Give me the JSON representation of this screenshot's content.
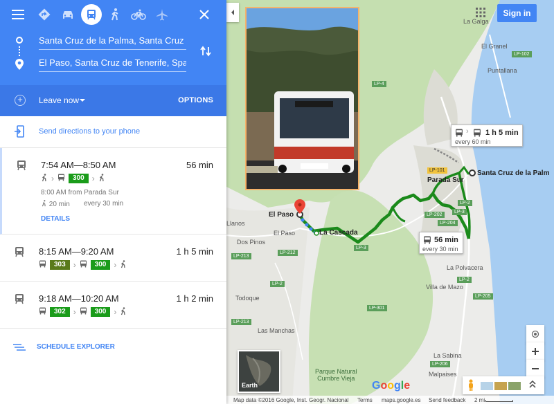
{
  "colors": {
    "primary": "#4285f4",
    "leave_bar": "#3b78e7",
    "route_green": "#1b8a1b",
    "line_300": "#1a9c1a",
    "line_302": "#1a9c1a",
    "line_303": "#5a7a1a",
    "link_blue": "#4285f4"
  },
  "travel_modes": [
    {
      "icon": "directions-icon"
    },
    {
      "icon": "car-icon"
    },
    {
      "icon": "transit-icon",
      "active": true
    },
    {
      "icon": "walk-icon"
    },
    {
      "icon": "bicycle-icon"
    },
    {
      "icon": "flight-icon"
    }
  ],
  "directions": {
    "from": "Santa Cruz de la Palma, Santa Cruz de T",
    "to": "El Paso, Santa Cruz de Tenerife, Spain"
  },
  "leave": {
    "label": "Leave now",
    "options": "OPTIONS"
  },
  "send_to_phone": "Send directions to your phone",
  "routes": [
    {
      "time": "7:54 AM—8:50 AM",
      "duration": "56 min",
      "lines": [
        "300"
      ],
      "departure": "8:00 AM from Parada Sur",
      "walk": "20 min",
      "frequency": "every 30 min",
      "details": "DETAILS"
    },
    {
      "time": "8:15 AM—9:20 AM",
      "duration": "1 h 5 min",
      "lines": [
        "303",
        "300"
      ]
    },
    {
      "time": "9:18 AM—10:20 AM",
      "duration": "1 h 2 min",
      "lines": [
        "302",
        "300"
      ]
    }
  ],
  "schedule_explorer": "SCHEDULE EXPLORER",
  "map": {
    "sign_in": "Sign in",
    "places": {
      "la_galga": "La Galga",
      "el_granel": "El Granel",
      "puntallana": "Puntallana",
      "santa_cruz": "Santa Cruz de la Palm",
      "parada_sur": "Parada Sur",
      "el_paso": "El Paso",
      "el_paso_small": "El Paso",
      "la_cascada": "La Cascada",
      "llanos": "Llanos",
      "dos_pinos": "Dos Pinos",
      "la_polvacera": "La Polvacera",
      "villa_de_mazo": "Villa de Mazo",
      "todoque": "Todoque",
      "las_manchas": "Las Manchas",
      "la_sabina": "La Sabina",
      "malpaises": "Malpaises",
      "cumbre_vieja": "Parque Natural\nCumbre Vieja"
    },
    "roads": [
      "LP-102",
      "LP-4",
      "LP-101",
      "LP-2",
      "LP-3",
      "LP-202",
      "LP-204",
      "LP-212",
      "LP-213",
      "LP-301",
      "LP-205",
      "LP-206"
    ],
    "card_alt": {
      "duration": "1 h 5 min",
      "frequency": "every 60 min"
    },
    "card_main": {
      "duration": "56 min",
      "frequency": "every 30 min"
    },
    "earth_label": "Earth",
    "google": "Google",
    "footer": {
      "data": "Map data ©2016 Google, Inst. Geogr. Nacional",
      "terms": "Terms",
      "site": "maps.google.es",
      "feedback": "Send feedback",
      "scale": "2 mi"
    }
  }
}
